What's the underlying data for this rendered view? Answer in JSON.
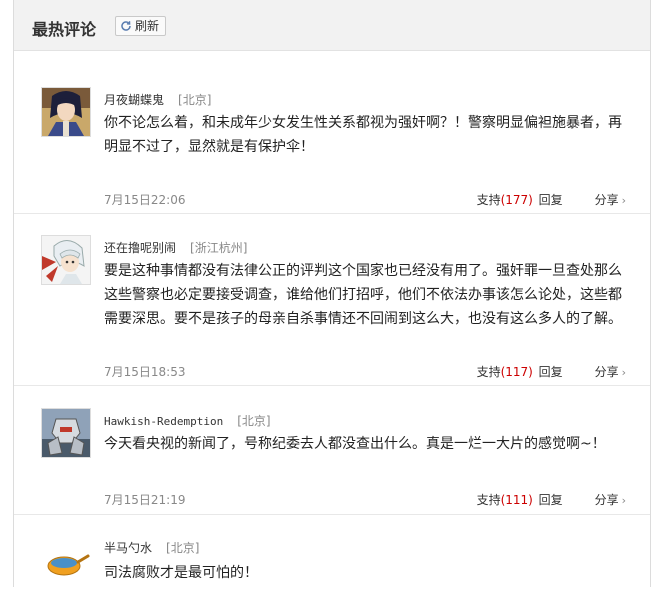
{
  "header": {
    "title": "最热评论",
    "refresh_label": "刷新"
  },
  "comments": [
    {
      "avatar": "anime-swordsman-avatar",
      "user": "月夜蝴蝶鬼",
      "location": "[北京]",
      "lines": [
        "你不论怎么着，和未成年少女发生性关系都视为强奸啊？！警察明显偏袒施暴者，再",
        "明显不过了，显然就是有保护伞！"
      ],
      "time": "7月15日22:06",
      "support_label": "支持",
      "support_count": "(177)",
      "reply_label": "回复",
      "share_label": "分享"
    },
    {
      "avatar": "white-hair-anime-avatar",
      "user": "还在撸呢别闹",
      "location": "[浙江杭州]",
      "lines": [
        "要是这种事情都没有法律公正的评判这个国家也已经没有用了。强奸罪一旦查处那么",
        "这些警察也必定要接受调查，谁给他们打招呼，他们不依法办事该怎么论处，这些都",
        "需要深思。要不是孩子的母亲自杀事情还不回闹到这么大，也没有这么多人的了解。"
      ],
      "time": "7月15日18:53",
      "support_label": "支持",
      "support_count": "(117)",
      "reply_label": "回复",
      "share_label": "分享"
    },
    {
      "avatar": "robot-mech-avatar",
      "user": "Hawkish-Redemption",
      "location": "[北京]",
      "lines": [
        "今天看央视的新闻了，号称纪委去人都没查出什么。真是一烂一大片的感觉啊~！"
      ],
      "time": "7月15日21:19",
      "support_label": "支持",
      "support_count": "(111)",
      "reply_label": "回复",
      "share_label": "分享"
    },
    {
      "avatar": "ladle-avatar",
      "user": "半马勺水",
      "location": "[北京]",
      "lines": [
        "司法腐败才是最可怕的！"
      ]
    }
  ]
}
